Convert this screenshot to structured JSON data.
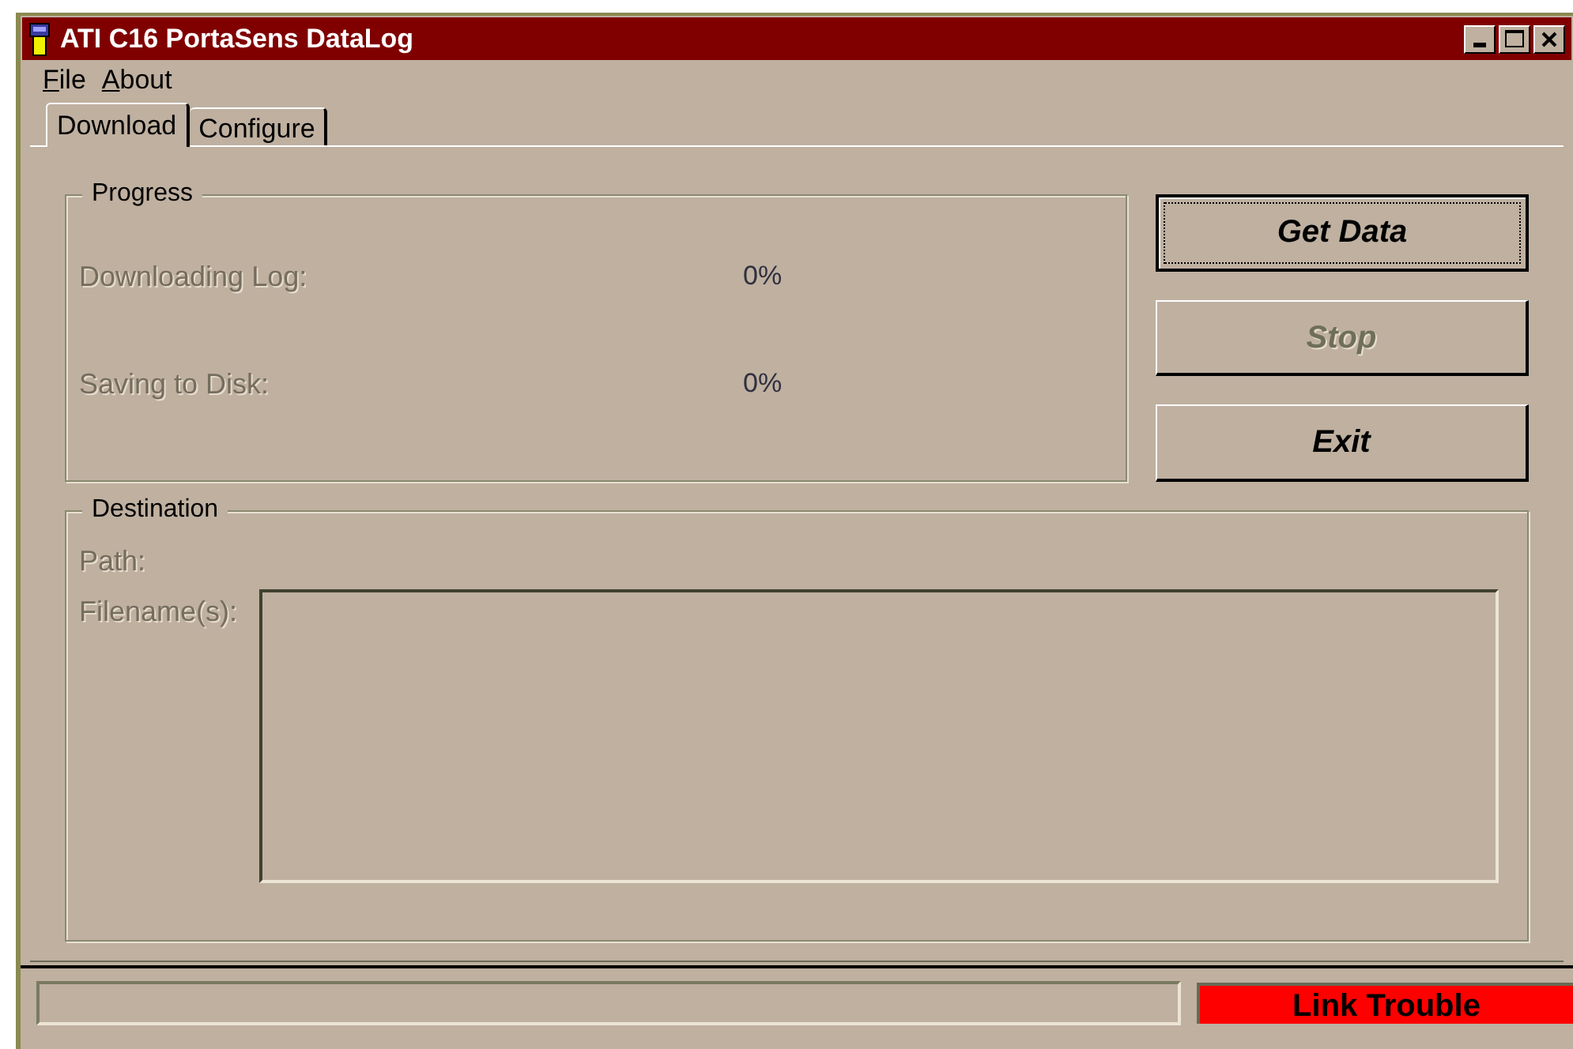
{
  "window": {
    "title": "ATI C16 PortaSens DataLog"
  },
  "menu": [
    {
      "label": "File"
    },
    {
      "label": "About"
    }
  ],
  "tabs": [
    {
      "label": "Download",
      "selected": true
    },
    {
      "label": "Configure",
      "selected": false
    }
  ],
  "progress": {
    "title": "Progress",
    "rows": [
      {
        "label": "Downloading Log:",
        "value": "0%",
        "disabled": true
      },
      {
        "label": "Saving to Disk:",
        "value": "0%",
        "disabled": true
      }
    ]
  },
  "buttons": [
    {
      "label": "Get Data",
      "focused": true,
      "disabled": false
    },
    {
      "label": "Stop",
      "focused": false,
      "disabled": true
    },
    {
      "label": "Exit",
      "focused": false,
      "disabled": false
    }
  ],
  "destination": {
    "title": "Destination",
    "path_label": "Path:",
    "filenames_label": "Filename(s):",
    "disabled": true
  },
  "status_bar": {
    "link_status": "Link Trouble",
    "alarm": true
  }
}
